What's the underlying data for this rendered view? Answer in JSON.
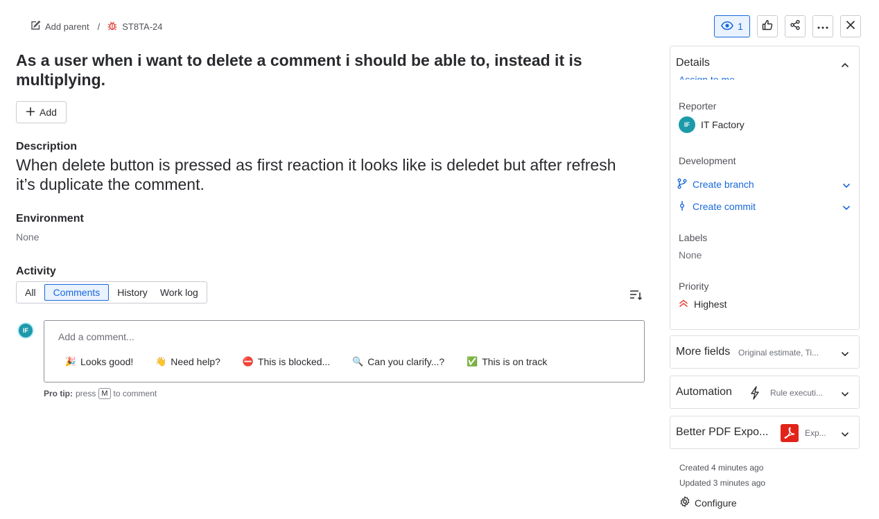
{
  "breadcrumb": {
    "add_parent_label": "Add parent",
    "separator": "/",
    "issue_key": "ST8TA-24"
  },
  "actions": {
    "watch_count": "1"
  },
  "issue": {
    "title": "As a user when i want to delete a comment i should be able to, instead it is multiplying.",
    "add_label": "Add",
    "description_heading": "Description",
    "description": "When delete button is pressed as first reaction it looks like is deledet but after refresh it’s duplicate the comment.",
    "environment_heading": "Environment",
    "environment_value": "None"
  },
  "activity": {
    "heading": "Activity",
    "tabs": [
      {
        "label": "All",
        "active": false
      },
      {
        "label": "Comments",
        "active": true
      },
      {
        "label": "History",
        "active": false
      },
      {
        "label": "Work log",
        "active": false
      }
    ],
    "avatar_initials": "IF",
    "comment_placeholder": "Add a comment...",
    "quick_replies": [
      {
        "label": "Looks good!",
        "emoji": "🎉"
      },
      {
        "label": "Need help?",
        "emoji": "👋"
      },
      {
        "label": "This is blocked...",
        "emoji": "⛔"
      },
      {
        "label": "Can you clarify...?",
        "emoji": "🔍"
      },
      {
        "label": "This is on track",
        "emoji": "✅"
      }
    ],
    "protip_bold": "Pro tip:",
    "protip_press": "press",
    "protip_key": "M",
    "protip_rest": "to comment"
  },
  "details": {
    "title": "Details",
    "assign_to_me": "Assign to me",
    "reporter_label": "Reporter",
    "reporter_initials": "IF",
    "reporter_name": "IT Factory",
    "development_label": "Development",
    "create_branch": "Create branch",
    "create_commit": "Create commit",
    "labels_label": "Labels",
    "labels_value": "None",
    "priority_label": "Priority",
    "priority_value": "Highest"
  },
  "more_fields": {
    "title": "More fields",
    "sub": "Original estimate, Ti..."
  },
  "automation": {
    "title": "Automation",
    "sub": "Rule executi..."
  },
  "pdf": {
    "title": "Better PDF Expo...",
    "sub": "Exp..."
  },
  "meta": {
    "created": "Created 4 minutes ago",
    "updated": "Updated 3 minutes ago",
    "configure": "Configure"
  },
  "colors": {
    "accent": "#1868db",
    "avatar": "#1d9aaa",
    "priority": "#e2483d",
    "bug": "#e2483d",
    "pdf": "#e2231a"
  }
}
